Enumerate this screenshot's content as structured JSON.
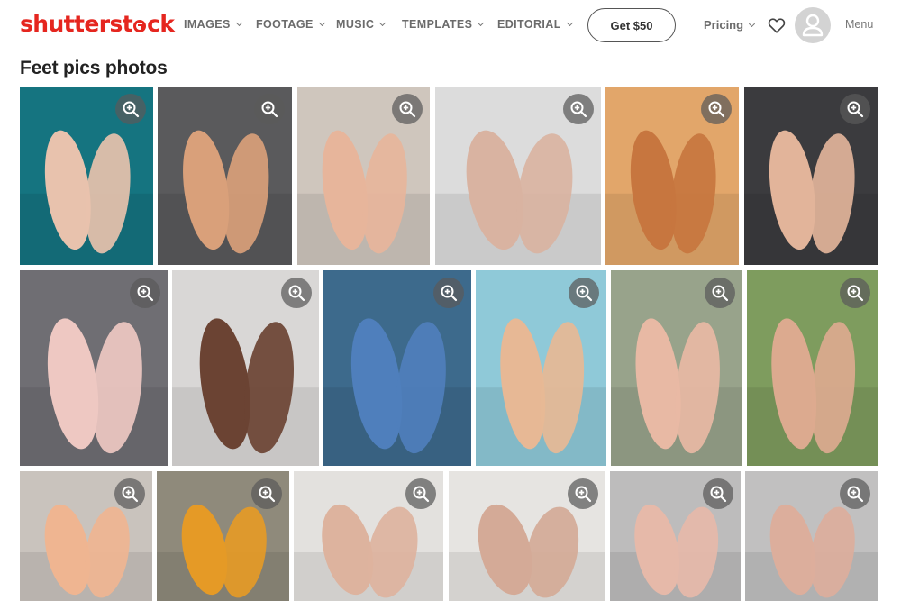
{
  "brand": {
    "logo_text_a": "shutterst",
    "logo_text_b": "ck",
    "accent": "#e5261f"
  },
  "nav": {
    "items": [
      {
        "label": "IMAGES"
      },
      {
        "label": "FOOTAGE"
      },
      {
        "label": "MUSIC"
      },
      {
        "label": "TEMPLATES"
      },
      {
        "label": "EDITORIAL"
      }
    ],
    "get_button": "Get $50",
    "pricing": "Pricing",
    "menu": "Menu",
    "icons": [
      "chevron-down-icon",
      "heart-icon",
      "user-icon",
      "zoom-in-icon"
    ]
  },
  "page": {
    "title": "Feet pics photos"
  },
  "tiles": [
    {
      "bg": "#157480",
      "skin": "#e8c2ad"
    },
    {
      "bg": "#5a5a5c",
      "skin": "#d9a07a"
    },
    {
      "bg": "#cfc6bd",
      "skin": "#e7b59b"
    },
    {
      "bg": "#dcdcdc",
      "skin": "#d9b3a1"
    },
    {
      "bg": "#e2a66a",
      "skin": "#c7763f"
    },
    {
      "bg": "#3b3b3e",
      "skin": "#e2b49a"
    },
    {
      "bg": "#6f6e73",
      "skin": "#eec8c2"
    },
    {
      "bg": "#d9d7d6",
      "skin": "#6b4333"
    },
    {
      "bg": "#3d6a8c",
      "skin": "#4f7fbc"
    },
    {
      "bg": "#8fc9d8",
      "skin": "#e7b895"
    },
    {
      "bg": "#98a38b",
      "skin": "#e8b9a4"
    },
    {
      "bg": "#7e9c5e",
      "skin": "#dcaa8f"
    },
    {
      "bg": "#c9c3bd",
      "skin": "#efb591"
    },
    {
      "bg": "#8f8a7b",
      "skin": "#e59a26"
    },
    {
      "bg": "#e3e1de",
      "skin": "#ddb39e"
    },
    {
      "bg": "#e6e4e1",
      "skin": "#d4aa97"
    },
    {
      "bg": "#bdbcbc",
      "skin": "#e6b9a9"
    },
    {
      "bg": "#c1c0c0",
      "skin": "#dcae9c"
    }
  ]
}
